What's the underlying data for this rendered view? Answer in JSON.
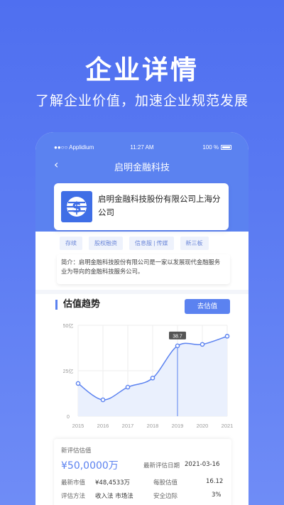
{
  "hero": {
    "title": "企业详情",
    "subtitle": "了解企业价值，加速企业规范发展"
  },
  "status_bar": {
    "carrier": "●●○○ Applidium",
    "time": "11:27 AM",
    "battery": "100 %"
  },
  "nav": {
    "back_icon": "‹",
    "title": "启明金融科技"
  },
  "company": {
    "name": "启明金融科技股份有限公司上海分公司"
  },
  "tags": [
    "存续",
    "股权融资",
    "信息服 | 传媒",
    "新三板"
  ],
  "intro": {
    "text": "简介：启明金融科技股份有限公司是一家以发展现代金融服务业为导向的金融科技服务公司。"
  },
  "trend": {
    "title": "估值趋势",
    "button": "去估值"
  },
  "chart_data": {
    "type": "line",
    "x": [
      "2015",
      "2016",
      "2017",
      "2018",
      "2019",
      "2020",
      "2021"
    ],
    "values": [
      18,
      9,
      16,
      21,
      38.7,
      39.5,
      44
    ],
    "ytick_labels": [
      "50亿",
      "25亿",
      "0"
    ],
    "ytick_values": [
      50,
      25,
      0
    ],
    "ylim": [
      0,
      50
    ],
    "highlight_index": 4,
    "highlight_label": "38.7",
    "grid": true,
    "colors": {
      "line": "#5b82f0",
      "fill": "#eaf0fd",
      "grid": "#eeeeee"
    }
  },
  "valuation": {
    "label": "新评估估值",
    "value": "¥50,0000万",
    "date_label": "最新评估日期",
    "date": "2021-03-16",
    "market_value_label": "最新市值",
    "market_value": "¥48,4533万",
    "per_share_label": "每股估值",
    "per_share": "16.12",
    "method_label": "评估方法",
    "method": "收入法 市场法",
    "margin_label": "安全边际",
    "margin": "3%"
  }
}
